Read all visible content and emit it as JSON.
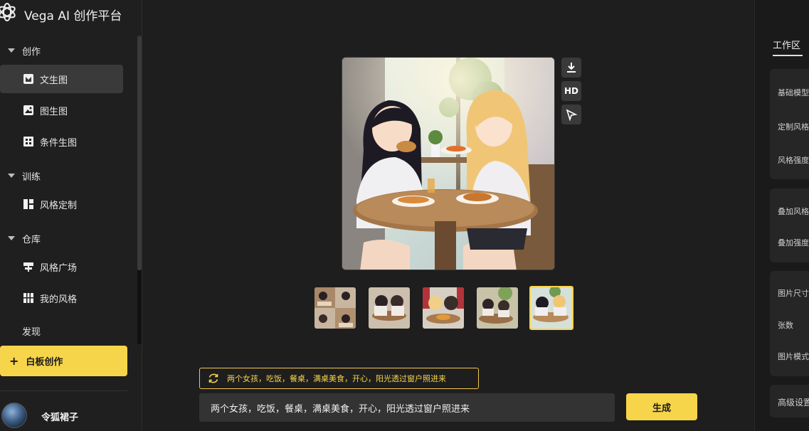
{
  "brand": {
    "title": "Vega AI 创作平台"
  },
  "sidebar": {
    "sections": [
      {
        "label": "创作"
      },
      {
        "label": "训练"
      },
      {
        "label": "仓库"
      }
    ],
    "items": [
      {
        "label": "文生图",
        "icon": "text-to-image-icon",
        "active": true
      },
      {
        "label": "图生图",
        "icon": "image-to-image-icon"
      },
      {
        "label": "条件生图",
        "icon": "conditional-image-icon"
      },
      {
        "label": "风格定制",
        "icon": "style-custom-icon"
      },
      {
        "label": "风格广场",
        "icon": "style-square-icon"
      },
      {
        "label": "我的风格",
        "icon": "my-style-icon"
      }
    ],
    "discover": "发现",
    "whiteboard": "白板创作",
    "user": {
      "name": "令狐裙子"
    }
  },
  "main": {
    "tools": {
      "hd_label": "HD"
    },
    "thumbnails_count": 5,
    "selected_thumbnail": 5,
    "prompt_tag": "两个女孩，吃饭，餐桌，满桌美食，开心，阳光透过窗户照进来",
    "prompt_value": "两个女孩，吃饭，餐桌，满桌美食，开心，阳光透过窗户照进来",
    "generate_label": "生成"
  },
  "right_panel": {
    "title": "工作区",
    "labels": [
      "基础模型",
      "定制风格",
      "风格强度",
      "叠加风格",
      "叠加强度",
      "图片尺寸",
      "张数",
      "图片模式",
      "高级设置"
    ]
  },
  "colors": {
    "accent": "#f7d54a",
    "bg": "#1e1e1e",
    "panel": "#262626"
  }
}
